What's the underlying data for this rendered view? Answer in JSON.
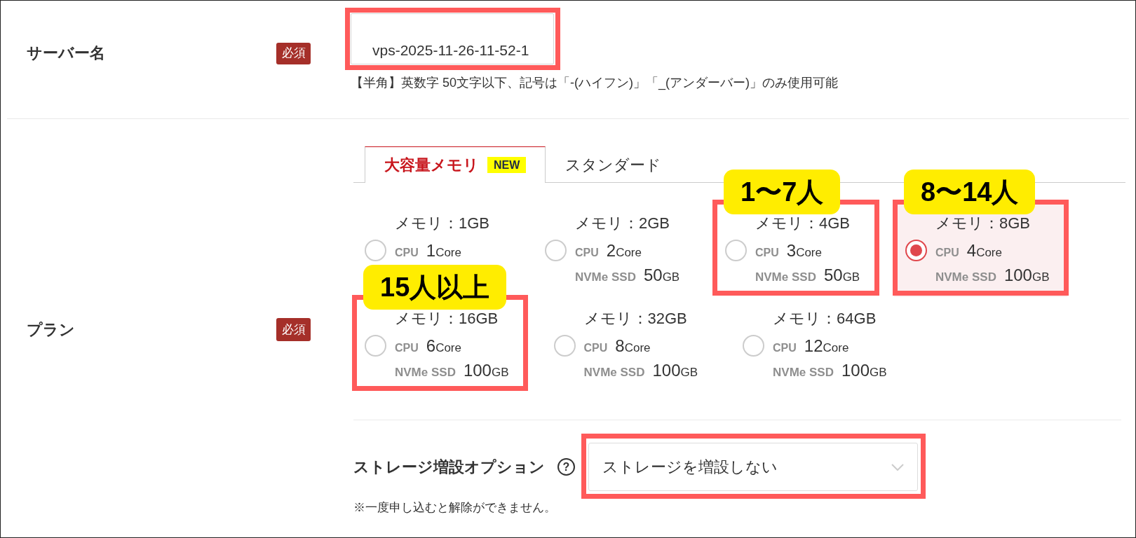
{
  "server_name": {
    "label": "サーバー名",
    "badge": "必須",
    "value": "vps-2025-11-26-11-52-1",
    "highlighted": true,
    "hint": "【半角】英数字 50文字以下、記号は「-(ハイフン)」「_(アンダーバー)」のみ使用可能"
  },
  "plan": {
    "label": "プラン",
    "badge": "必須",
    "tabs": [
      {
        "label": "大容量メモリ",
        "badge": "NEW",
        "selected": true
      },
      {
        "label": "スタンダード",
        "selected": false
      }
    ],
    "options": [
      {
        "memory": "メモリ：1GB",
        "cpu_label": "CPU",
        "cpu": "1",
        "cpu_unit": "Core",
        "selected": false,
        "highlighted": false
      },
      {
        "memory": "メモリ：2GB",
        "cpu_label": "CPU",
        "cpu": "2",
        "cpu_unit": "Core",
        "ssd_label": "NVMe SSD",
        "ssd": "50",
        "ssd_unit": "GB",
        "selected": false,
        "highlighted": false
      },
      {
        "memory": "メモリ：4GB",
        "cpu_label": "CPU",
        "cpu": "3",
        "cpu_unit": "Core",
        "ssd_label": "NVMe SSD",
        "ssd": "50",
        "ssd_unit": "GB",
        "selected": false,
        "highlighted": true,
        "callout": "1〜7人"
      },
      {
        "memory": "メモリ：8GB",
        "cpu_label": "CPU",
        "cpu": "4",
        "cpu_unit": "Core",
        "ssd_label": "NVMe SSD",
        "ssd": "100",
        "ssd_unit": "GB",
        "selected": true,
        "highlighted": true,
        "callout": "8〜14人"
      },
      {
        "memory": "メモリ：16GB",
        "cpu_label": "CPU",
        "cpu": "6",
        "cpu_unit": "Core",
        "ssd_label": "NVMe SSD",
        "ssd": "100",
        "ssd_unit": "GB",
        "selected": false,
        "highlighted": true,
        "callout": "15人以上"
      },
      {
        "memory": "メモリ：32GB",
        "cpu_label": "CPU",
        "cpu": "8",
        "cpu_unit": "Core",
        "ssd_label": "NVMe SSD",
        "ssd": "100",
        "ssd_unit": "GB",
        "selected": false,
        "highlighted": false
      },
      {
        "memory": "メモリ：64GB",
        "cpu_label": "CPU",
        "cpu": "12",
        "cpu_unit": "Core",
        "ssd_label": "NVMe SSD",
        "ssd": "100",
        "ssd_unit": "GB",
        "selected": false,
        "highlighted": false
      }
    ],
    "storage_option": {
      "label": "ストレージ増設オプション",
      "help_icon": "?",
      "value": "ストレージを増設しない",
      "highlighted": true,
      "note": "※一度申し込むと解除ができません。"
    }
  }
}
